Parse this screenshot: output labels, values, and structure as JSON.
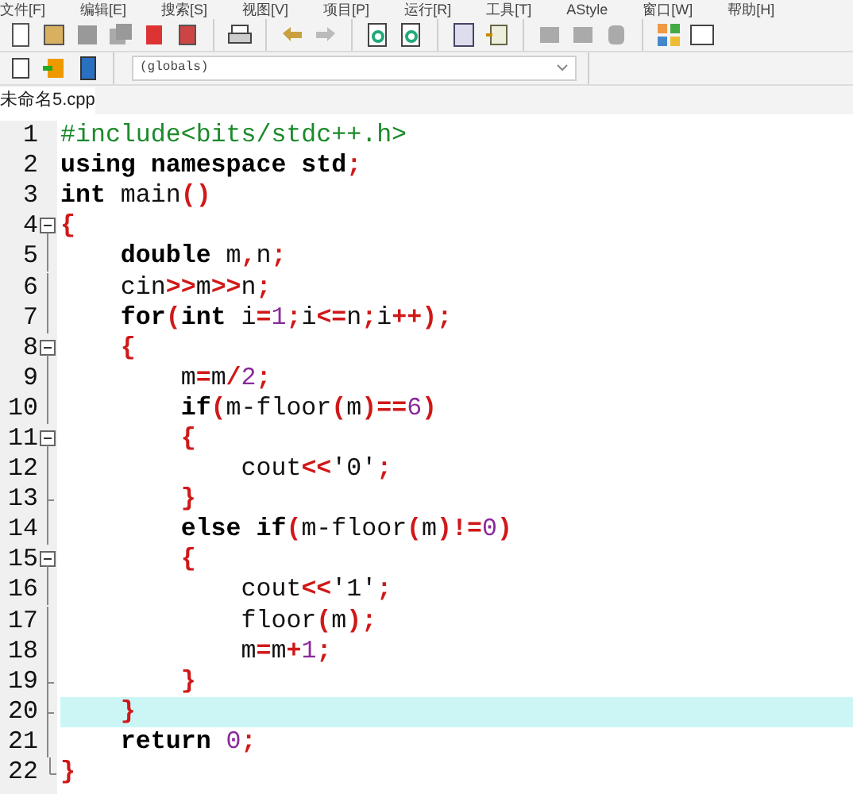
{
  "menu": [
    "文件[F]",
    "编辑[E]",
    "搜索[S]",
    "视图[V]",
    "项目[P]",
    "运行[R]",
    "工具[T]",
    "AStyle",
    "窗口[W]",
    "帮助[H]"
  ],
  "scope_select": {
    "value": "(globals)"
  },
  "tabs": [
    {
      "label": "未命名5.cpp",
      "selected": true
    }
  ],
  "lines": [
    {
      "number": "1",
      "kind": "none",
      "selected": false,
      "tokens": [
        {
          "kind": "p",
          "text": "#include<bits/stdc++.h>"
        }
      ]
    },
    {
      "number": "2",
      "kind": "none",
      "selected": false,
      "tokens": [
        {
          "kind": "k",
          "text": "using namespace std"
        },
        {
          "kind": "s",
          "text": ";"
        }
      ]
    },
    {
      "number": "3",
      "kind": "none",
      "selected": false,
      "tokens": [
        {
          "kind": "k",
          "text": "int"
        },
        {
          "kind": "t",
          "text": " main"
        },
        {
          "kind": "s",
          "text": "()"
        }
      ]
    },
    {
      "number": "4",
      "kind": "start",
      "selected": false,
      "tokens": [
        {
          "kind": "s",
          "text": "{"
        }
      ]
    },
    {
      "number": "5",
      "kind": "line",
      "selected": false,
      "tokens": [
        {
          "kind": "k",
          "text": "    double"
        },
        {
          "kind": "t",
          "text": " m"
        },
        {
          "kind": "s",
          "text": ","
        },
        {
          "kind": "t",
          "text": "n"
        },
        {
          "kind": "s",
          "text": ";"
        }
      ]
    },
    {
      "number": "6",
      "kind": "line",
      "selected": false,
      "tokens": [
        {
          "kind": "t",
          "text": "    cin"
        },
        {
          "kind": "s",
          "text": ">>"
        },
        {
          "kind": "t",
          "text": "m"
        },
        {
          "kind": "s",
          "text": ">>"
        },
        {
          "kind": "t",
          "text": "n"
        },
        {
          "kind": "s",
          "text": ";"
        }
      ]
    },
    {
      "number": "7",
      "kind": "line",
      "selected": false,
      "tokens": [
        {
          "kind": "k",
          "text": "    for"
        },
        {
          "kind": "s",
          "text": "("
        },
        {
          "kind": "k",
          "text": "int"
        },
        {
          "kind": "t",
          "text": " i"
        },
        {
          "kind": "s",
          "text": "="
        },
        {
          "kind": "n",
          "text": "1"
        },
        {
          "kind": "s",
          "text": ";"
        },
        {
          "kind": "t",
          "text": "i"
        },
        {
          "kind": "s",
          "text": "<="
        },
        {
          "kind": "t",
          "text": "n"
        },
        {
          "kind": "s",
          "text": ";"
        },
        {
          "kind": "t",
          "text": "i"
        },
        {
          "kind": "s",
          "text": "++);"
        }
      ]
    },
    {
      "number": "8",
      "kind": "start",
      "selected": false,
      "tokens": [
        {
          "kind": "s",
          "text": "    {"
        }
      ]
    },
    {
      "number": "9",
      "kind": "line",
      "selected": false,
      "tokens": [
        {
          "kind": "t",
          "text": "        m"
        },
        {
          "kind": "s",
          "text": "="
        },
        {
          "kind": "t",
          "text": "m"
        },
        {
          "kind": "s",
          "text": "/"
        },
        {
          "kind": "n",
          "text": "2"
        },
        {
          "kind": "s",
          "text": ";"
        }
      ]
    },
    {
      "number": "10",
      "kind": "line",
      "selected": false,
      "tokens": [
        {
          "kind": "k",
          "text": "        if"
        },
        {
          "kind": "s",
          "text": "("
        },
        {
          "kind": "t",
          "text": "m-floor"
        },
        {
          "kind": "s",
          "text": "("
        },
        {
          "kind": "t",
          "text": "m"
        },
        {
          "kind": "s",
          "text": ")=="
        },
        {
          "kind": "n",
          "text": "6"
        },
        {
          "kind": "s",
          "text": ")"
        }
      ]
    },
    {
      "number": "11",
      "kind": "start",
      "selected": false,
      "tokens": [
        {
          "kind": "s",
          "text": "        {"
        }
      ]
    },
    {
      "number": "12",
      "kind": "line",
      "selected": false,
      "tokens": [
        {
          "kind": "t",
          "text": "            cout"
        },
        {
          "kind": "s",
          "text": "<<"
        },
        {
          "kind": "t",
          "text": "'0'"
        },
        {
          "kind": "s",
          "text": ";"
        }
      ]
    },
    {
      "number": "13",
      "kind": "end",
      "selected": false,
      "tokens": [
        {
          "kind": "s",
          "text": "        }"
        }
      ]
    },
    {
      "number": "14",
      "kind": "line",
      "selected": false,
      "tokens": [
        {
          "kind": "k",
          "text": "        else if"
        },
        {
          "kind": "s",
          "text": "("
        },
        {
          "kind": "t",
          "text": "m-floor"
        },
        {
          "kind": "s",
          "text": "("
        },
        {
          "kind": "t",
          "text": "m"
        },
        {
          "kind": "s",
          "text": ")!="
        },
        {
          "kind": "n",
          "text": "0"
        },
        {
          "kind": "s",
          "text": ")"
        }
      ]
    },
    {
      "number": "15",
      "kind": "start",
      "selected": false,
      "tokens": [
        {
          "kind": "s",
          "text": "        {"
        }
      ]
    },
    {
      "number": "16",
      "kind": "line",
      "selected": false,
      "tokens": [
        {
          "kind": "t",
          "text": "            cout"
        },
        {
          "kind": "s",
          "text": "<<"
        },
        {
          "kind": "t",
          "text": "'1'"
        },
        {
          "kind": "s",
          "text": ";"
        }
      ]
    },
    {
      "number": "17",
      "kind": "line",
      "selected": false,
      "tokens": [
        {
          "kind": "t",
          "text": "            floor"
        },
        {
          "kind": "s",
          "text": "("
        },
        {
          "kind": "t",
          "text": "m"
        },
        {
          "kind": "s",
          "text": ");"
        }
      ]
    },
    {
      "number": "18",
      "kind": "line",
      "selected": false,
      "tokens": [
        {
          "kind": "t",
          "text": "            m"
        },
        {
          "kind": "s",
          "text": "="
        },
        {
          "kind": "t",
          "text": "m"
        },
        {
          "kind": "s",
          "text": "+"
        },
        {
          "kind": "n",
          "text": "1"
        },
        {
          "kind": "s",
          "text": ";"
        }
      ]
    },
    {
      "number": "19",
      "kind": "end",
      "selected": false,
      "tokens": [
        {
          "kind": "s",
          "text": "        }"
        }
      ]
    },
    {
      "number": "20",
      "kind": "end",
      "selected": true,
      "tokens": [
        {
          "kind": "s",
          "text": "    }"
        }
      ]
    },
    {
      "number": "21",
      "kind": "line",
      "selected": false,
      "tokens": [
        {
          "kind": "k",
          "text": "    return"
        },
        {
          "kind": "n",
          "text": " 0"
        },
        {
          "kind": "s",
          "text": ";"
        }
      ]
    },
    {
      "number": "22",
      "kind": "last",
      "selected": false,
      "tokens": [
        {
          "kind": "s",
          "text": "}"
        }
      ]
    }
  ]
}
